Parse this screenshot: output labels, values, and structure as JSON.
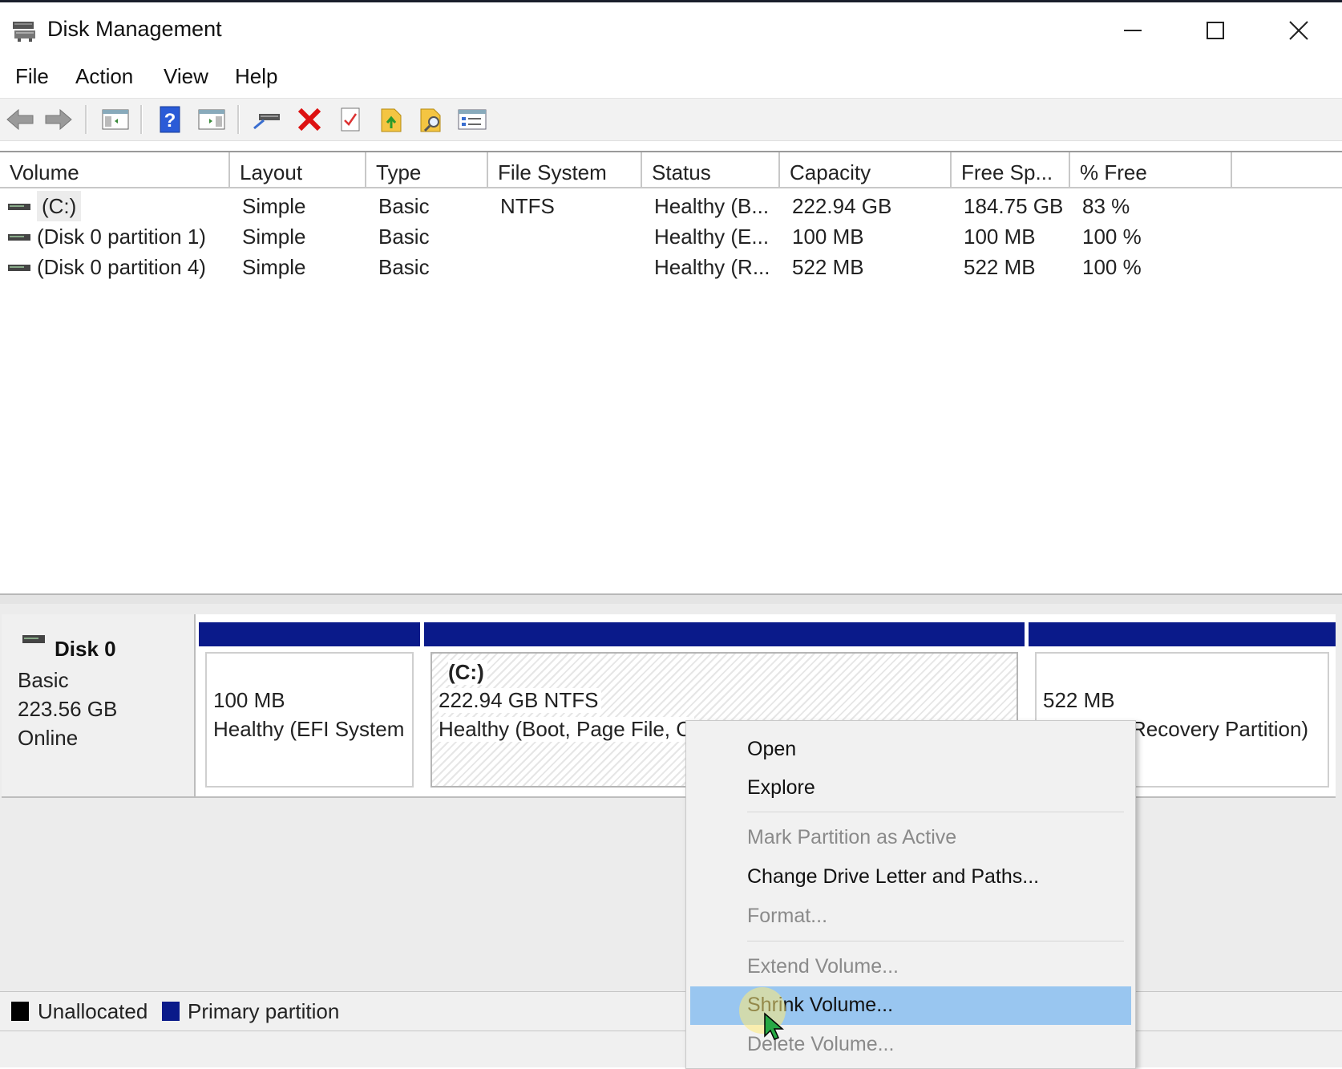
{
  "window": {
    "title": "Disk Management"
  },
  "menu": [
    "File",
    "Action",
    "View",
    "Help"
  ],
  "toolbar_icons": [
    "back-arrow-icon",
    "forward-arrow-icon",
    "show-hide-console-tree-icon",
    "help-icon",
    "show-hide-action-pane-icon",
    "connect-disk-icon",
    "delete-icon",
    "properties-icon",
    "export-list-icon",
    "find-icon",
    "view-settings-icon"
  ],
  "volume_table": {
    "columns": [
      "Volume",
      "Layout",
      "Type",
      "File System",
      "Status",
      "Capacity",
      "Free Sp...",
      "% Free"
    ],
    "rows": [
      {
        "volume": "(C:)",
        "layout": "Simple",
        "type": "Basic",
        "fs": "NTFS",
        "status": "Healthy (B...",
        "capacity": "222.94 GB",
        "free": "184.75 GB",
        "pct": "83 %"
      },
      {
        "volume": "(Disk 0 partition 1)",
        "layout": "Simple",
        "type": "Basic",
        "fs": "",
        "status": "Healthy (E...",
        "capacity": "100 MB",
        "free": "100 MB",
        "pct": "100 %"
      },
      {
        "volume": "(Disk 0 partition 4)",
        "layout": "Simple",
        "type": "Basic",
        "fs": "",
        "status": "Healthy (R...",
        "capacity": "522 MB",
        "free": "522 MB",
        "pct": "100 %"
      }
    ]
  },
  "disk": {
    "name": "Disk 0",
    "type": "Basic",
    "size": "223.56 GB",
    "state": "Online",
    "partitions": [
      {
        "title": "",
        "size": "100 MB",
        "status": "Healthy (EFI System I"
      },
      {
        "title": "(C:)",
        "size": "222.94 GB NTFS",
        "status": "Healthy (Boot, Page File, C"
      },
      {
        "title": "",
        "size": "522 MB",
        "status": "Recovery Partition)"
      }
    ]
  },
  "legend": {
    "unallocated": "Unallocated",
    "primary": "Primary partition",
    "unallocated_color": "#000000",
    "primary_color": "#0a1a8a"
  },
  "context_menu": {
    "items": [
      {
        "label": "Open",
        "enabled": true
      },
      {
        "label": "Explore",
        "enabled": true
      },
      {
        "label": "Mark Partition as Active",
        "enabled": false
      },
      {
        "label": "Change Drive Letter and Paths...",
        "enabled": true
      },
      {
        "label": "Format...",
        "enabled": false
      },
      {
        "label": "Extend Volume...",
        "enabled": false
      },
      {
        "label": "Shrink Volume...",
        "enabled": true,
        "highlighted": true
      },
      {
        "label": "Delete Volume...",
        "enabled": false
      }
    ]
  }
}
